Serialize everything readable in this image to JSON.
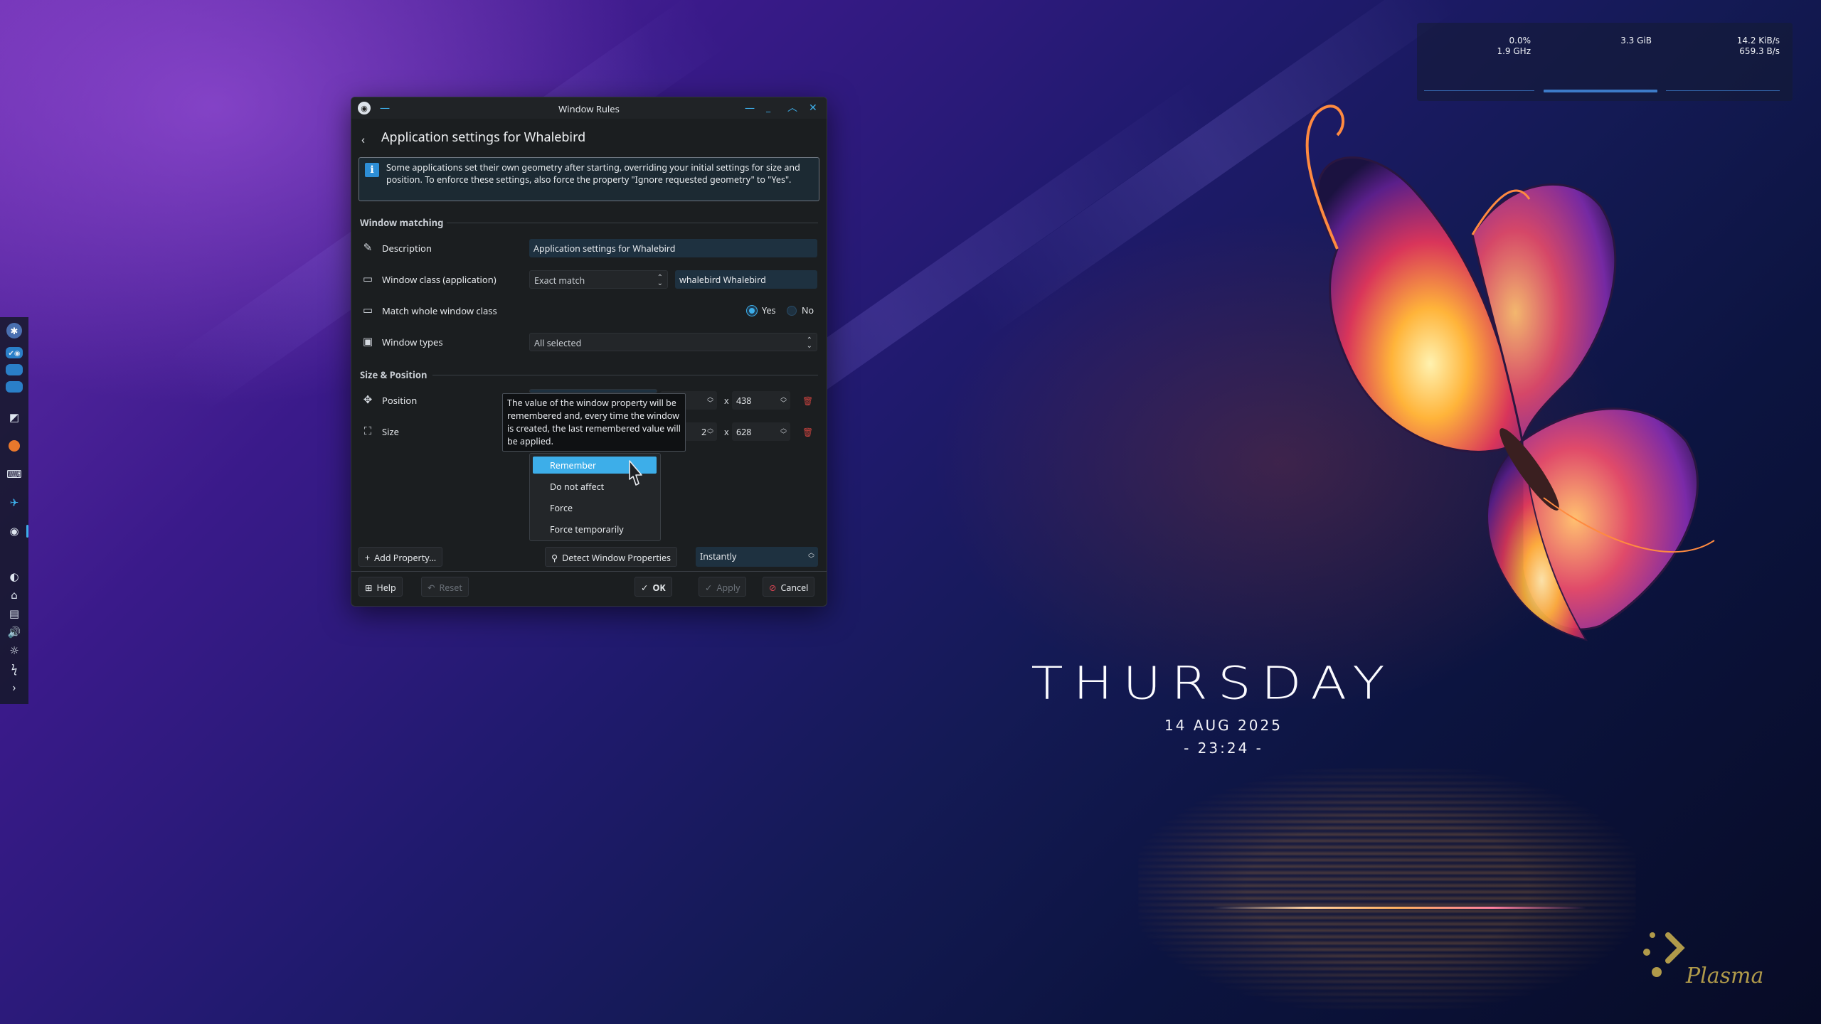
{
  "window": {
    "title": "Window Rules",
    "header": "Application settings for Whalebird",
    "info_message": "Some applications set their own geometry after starting, overriding your initial settings for size and position. To enforce these settings, also force the property \"Ignore requested geometry\" to \"Yes\".",
    "sections": {
      "matching": "Window matching",
      "size_position": "Size & Position"
    },
    "rows": {
      "description": {
        "label": "Description",
        "value": "Application settings for Whalebird"
      },
      "window_class": {
        "label": "Window class (application)",
        "match": "Exact match",
        "value": "whalebird Whalebird"
      },
      "match_whole": {
        "label": "Match whole window class",
        "yes": "Yes",
        "no": "No",
        "selected": "Yes"
      },
      "window_types": {
        "label": "Window types",
        "value": "All selected"
      },
      "position": {
        "label": "Position",
        "x_partial": "",
        "y": "438"
      },
      "size": {
        "label": "Size",
        "w_partial": "2",
        "h": "628"
      }
    },
    "tooltip": "The value of the window property will be remembered and, every time the window is created, the last remembered value will be applied.",
    "policy_menu": [
      "Remember",
      "Do not affect",
      "Force",
      "Force temporarily"
    ],
    "policy_selected": "Remember",
    "add_property": "Add Property...",
    "detect_properties": "Detect Window Properties",
    "detect_delay": "Instantly",
    "buttons": {
      "help": "Help",
      "reset": "Reset",
      "ok": "OK",
      "apply": "Apply",
      "cancel": "Cancel"
    },
    "multiply_sign": "x"
  },
  "sysmon": {
    "cpu_usage": "0.0%",
    "cpu_freq": "1.9 GHz",
    "memory": "3.3 GiB",
    "net_down": "14.2 KiB/s",
    "net_up": "659.3 B/s"
  },
  "clock": {
    "day": "THURSDAY",
    "date": "14 AUG 2025",
    "time": "- 23:24 -"
  },
  "branding": "Plasma",
  "colors": {
    "accent": "#3daee9",
    "danger": "#c8423e",
    "dialog_bg": "#1b1e20"
  }
}
